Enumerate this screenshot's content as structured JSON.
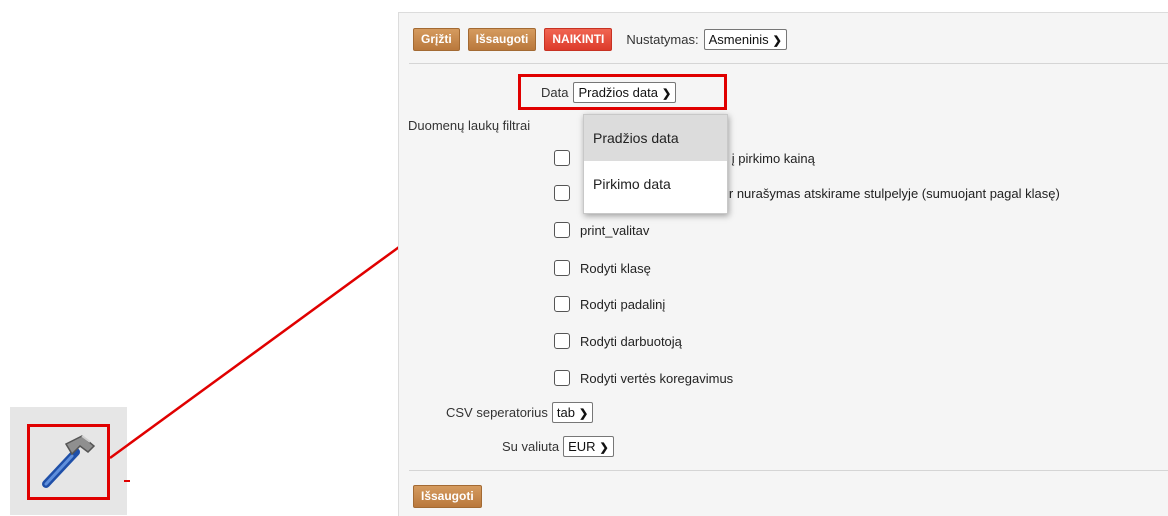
{
  "toolbar": {
    "back_label": "Grįžti",
    "save_label": "Išsaugoti",
    "delete_label": "NAIKINTI",
    "setting_label": "Nustatymas:",
    "setting_value": "Asmeninis"
  },
  "date": {
    "label": "Data",
    "value": "Pradžios data",
    "options": [
      "Pradžios data",
      "Pirkimo data"
    ]
  },
  "filters": {
    "label": "Duomenų laukų filtrai",
    "items": [
      "netraukia nurašymų į pirkimo kainą",
      "ir nurašymas atskirame stulpelyje (sumuojant pagal klasę)",
      "print_valitav",
      "Rodyti klasę",
      "Rodyti padalinį",
      "Rodyti darbuotoją",
      "Rodyti vertės koregavimus"
    ],
    "hidden_partial": {
      "item0_prefix_fragment": "e",
      "item1_prefix_fragment": "a"
    }
  },
  "csv": {
    "label": "CSV seperatorius",
    "value": "tab"
  },
  "currency": {
    "label": "Su valiuta",
    "value": "EUR"
  },
  "bottom": {
    "save_label": "Išsaugoti"
  },
  "colors": {
    "brown_button": "#c8894b",
    "red_button": "#e84a3a",
    "highlight": "#e00000"
  },
  "icons": {
    "settings_tool": "hammer-icon",
    "select_arrow": "chevron-down-icon"
  }
}
